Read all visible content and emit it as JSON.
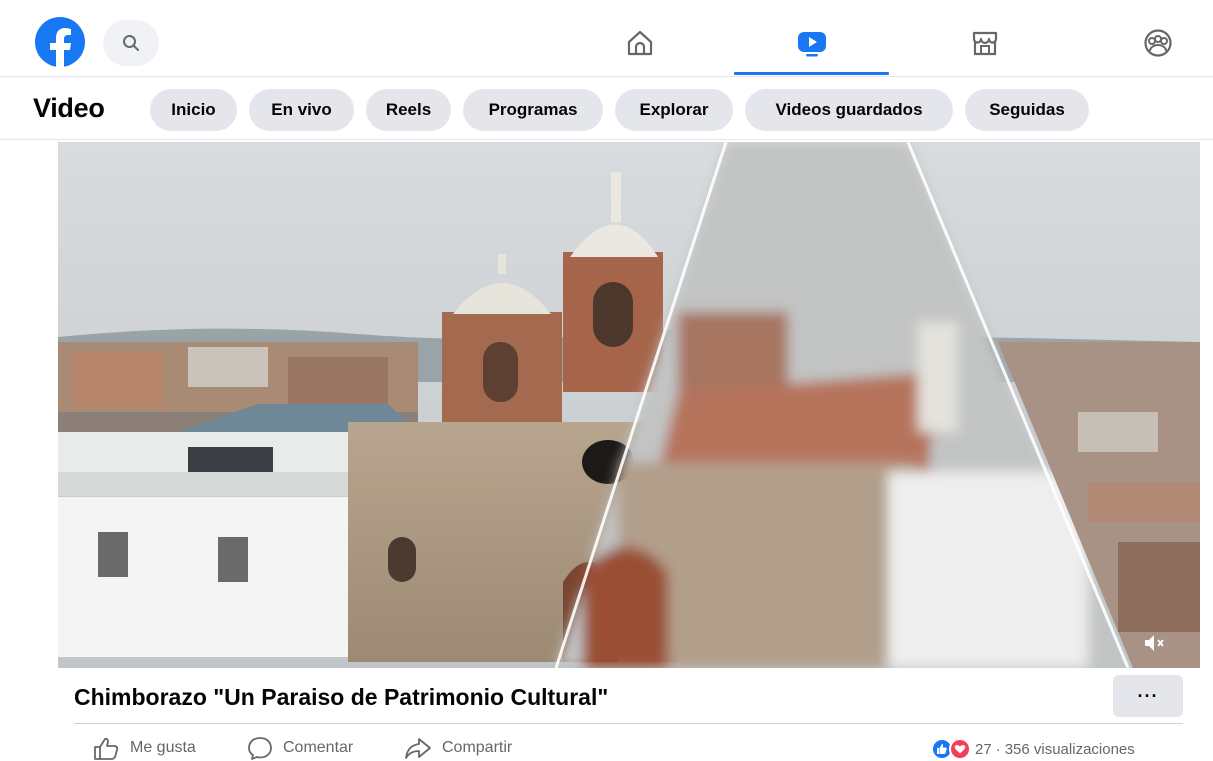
{
  "nav": {
    "icons": [
      "home-icon",
      "watch-icon",
      "marketplace-icon",
      "groups-icon"
    ],
    "active": "watch-icon"
  },
  "subnav": {
    "title": "Video",
    "tabs": [
      "Inicio",
      "En vivo",
      "Reels",
      "Programas",
      "Explorar",
      "Videos guardados",
      "Seguidas"
    ]
  },
  "post": {
    "title": "Chimborazo \"Un Paraiso de Patrimonio Cultural\"",
    "more_label": "···",
    "actions": {
      "like": "Me gusta",
      "comment": "Comentar",
      "share": "Compartir"
    },
    "reaction_count": "27",
    "separator": "·",
    "views": "356 visualizaciones"
  },
  "colors": {
    "accent": "#1877f2",
    "like": "#1877f2",
    "love": "#f33e58"
  }
}
